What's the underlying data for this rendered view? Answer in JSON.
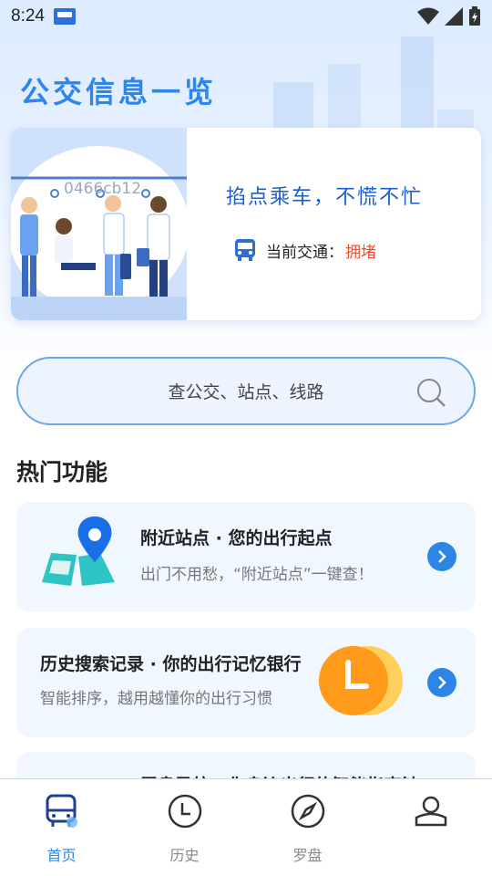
{
  "status_bar": {
    "time": "8:24"
  },
  "header": {
    "title": "公交信息一览"
  },
  "banner": {
    "overlay_code": "0466cb12",
    "slogan": "掐点乘车，不慌不忙",
    "traffic_label": "当前交通：",
    "traffic_status": "拥堵",
    "traffic_status_color": "#f24a2a"
  },
  "search": {
    "placeholder": "查公交、站点、线路"
  },
  "section": {
    "title": "热门功能"
  },
  "features": [
    {
      "title": "附近站点 · 您的出行起点",
      "desc": "出门不用愁，“附近站点”一键查！",
      "icon": "map-pin-icon"
    },
    {
      "title": "历史搜索记录 · 你的出行记忆银行",
      "desc": "智能排序，越用越懂你的出行习惯",
      "icon": "clock-icon"
    },
    {
      "title": "罗盘导航 · 你身边出行的智能指南针",
      "desc": "",
      "icon": "compass-icon"
    }
  ],
  "tabbar": {
    "tabs": [
      {
        "label": "首页",
        "icon": "bus-icon",
        "active": true
      },
      {
        "label": "历史",
        "icon": "clock-icon",
        "active": false
      },
      {
        "label": "罗盘",
        "icon": "compass-icon",
        "active": false
      },
      {
        "label": "",
        "icon": "user-icon",
        "active": false
      }
    ]
  },
  "colors": {
    "accent": "#2d86e6",
    "title_blue": "#2f86e8"
  }
}
